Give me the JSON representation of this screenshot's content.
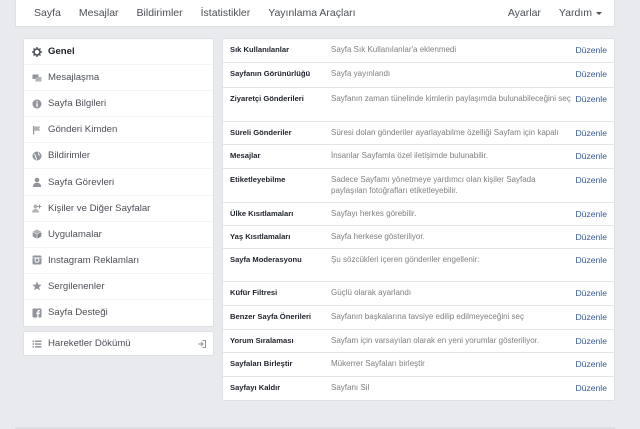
{
  "topnav": {
    "items": [
      "Sayfa",
      "Mesajlar",
      "Bildirimler",
      "İstatistikler",
      "Yayınlama Araçları"
    ],
    "settings": "Ayarlar",
    "help": "Yardım"
  },
  "sidebar": {
    "items": [
      {
        "label": "Genel",
        "icon": "gear-icon",
        "active": true
      },
      {
        "label": "Mesajlaşma",
        "icon": "message-icon"
      },
      {
        "label": "Sayfa Bilgileri",
        "icon": "info-icon"
      },
      {
        "label": "Gönderi Kimden",
        "icon": "flag-icon"
      },
      {
        "label": "Bildirimler",
        "icon": "globe-icon"
      },
      {
        "label": "Sayfa Görevleri",
        "icon": "person-icon"
      },
      {
        "label": "Kişiler ve Diğer Sayfalar",
        "icon": "people-icon"
      },
      {
        "label": "Uygulamalar",
        "icon": "cube-icon"
      },
      {
        "label": "Instagram Reklamları",
        "icon": "instagram-icon"
      },
      {
        "label": "Sergilenenler",
        "icon": "star-icon"
      },
      {
        "label": "Sayfa Desteği",
        "icon": "facebook-icon"
      }
    ],
    "activity_log": "Hareketler Dökümü"
  },
  "settings": {
    "edit_label": "Düzenle",
    "rows": [
      {
        "name": "Sık Kullanılanlar",
        "desc": "Sayfa Sık Kullanılanlar'a eklenmedi"
      },
      {
        "name": "Sayfanın Görünürlüğü",
        "desc": "Sayfa yayınlandı"
      },
      {
        "name": "Ziyaretçi Gönderileri",
        "desc": "Sayfanın zaman tünelinde kimlerin paylaşımda bulunabileceğini seç"
      },
      {
        "name": "Süreli Gönderiler",
        "desc": "Süresi dolan gönderiler ayarlayabilme özelliği Sayfam için kapalı"
      },
      {
        "name": "Mesajlar",
        "desc": "İnsanlar Sayfamla özel iletişimde bulunabilir."
      },
      {
        "name": "Etiketleyebilme",
        "desc": "Sadece Sayfamı yönetmeye yardımcı olan kişiler Sayfada paylaşılan fotoğrafları etiketleyebilir."
      },
      {
        "name": "Ülke Kısıtlamaları",
        "desc": "Sayfayı herkes görebilir."
      },
      {
        "name": "Yaş Kısıtlamaları",
        "desc": "Sayfa herkese gösteriliyor."
      },
      {
        "name": "Sayfa Moderasyonu",
        "desc": "Şu sözcükleri içeren gönderiler engellenir:"
      },
      {
        "name": "Küfür Filtresi",
        "desc": "Güçlü olarak ayarlandı"
      },
      {
        "name": "Benzer Sayfa Önerileri",
        "desc": "Sayfanın başkalarına tavsiye edilip edilmeyeceğini seç"
      },
      {
        "name": "Yorum Sıralaması",
        "desc": "Sayfam için varsayılan olarak en yeni yorumlar gösteriliyor."
      },
      {
        "name": "Sayfaları Birleştir",
        "desc": "Mükerrer Sayfaları birleştir"
      },
      {
        "name": "Sayfayı Kaldır",
        "desc": "Sayfanı Sil"
      }
    ]
  },
  "colors": {
    "background": "#e9eaed",
    "link": "#365899",
    "panel": "#ffffff"
  }
}
